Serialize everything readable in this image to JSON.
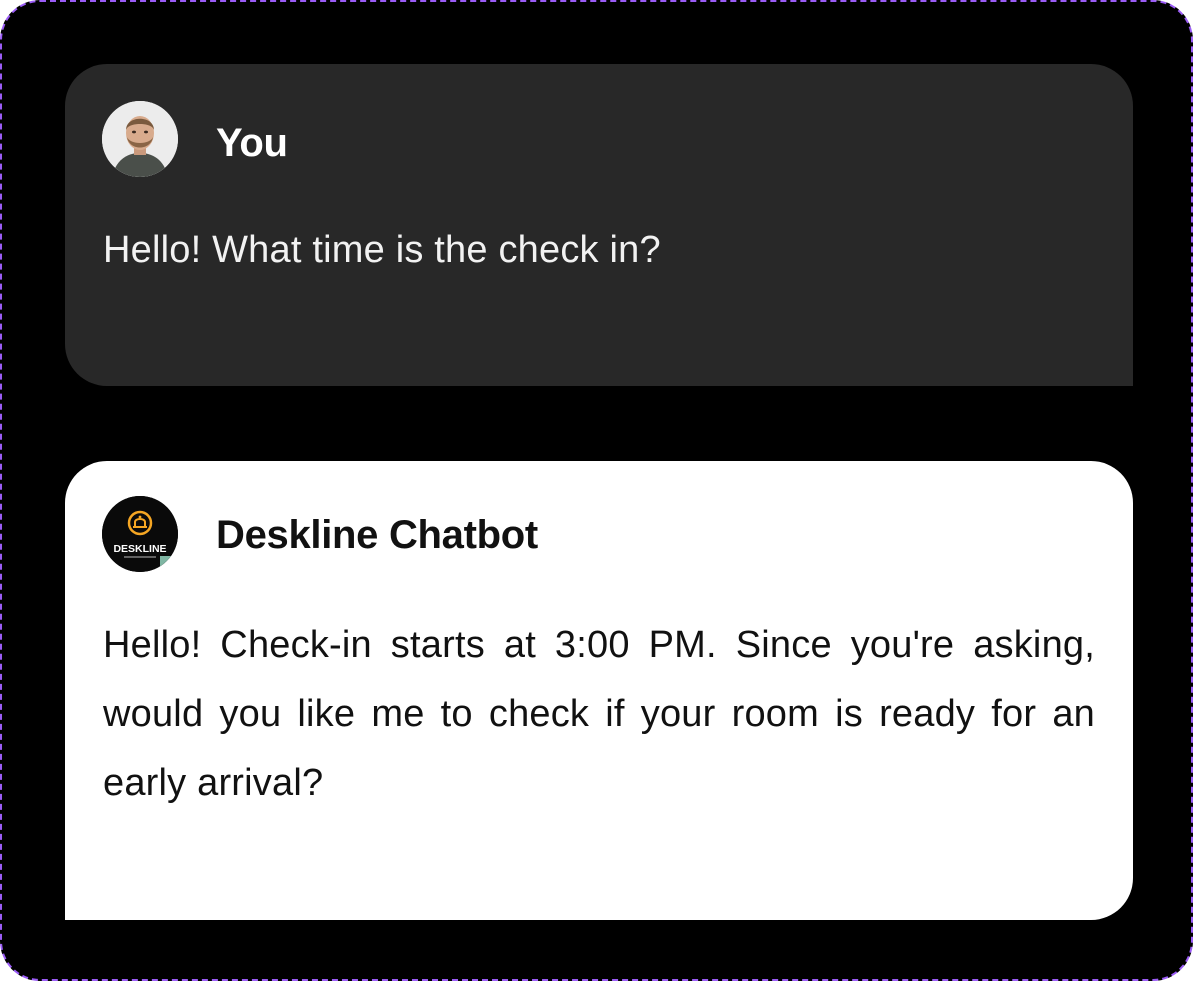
{
  "conversation": {
    "messages": [
      {
        "sender": "You",
        "avatar_icon": "user-avatar-photo",
        "text": "Hello! What time is the check in?"
      },
      {
        "sender": "Deskline Chatbot",
        "avatar_icon": "deskline-logo",
        "logo_text": "DESKLINE",
        "text": "Hello! Check-in starts at 3:00 PM. Since you're asking, would you like me to check if your room is ready for an early arrival?"
      }
    ]
  },
  "colors": {
    "background": "#000000",
    "frame_border": "#9b5cf6",
    "user_bubble": "#282828",
    "bot_bubble": "#ffffff",
    "logo_accent": "#f5a623",
    "logo_corner": "#7fb6a3"
  }
}
